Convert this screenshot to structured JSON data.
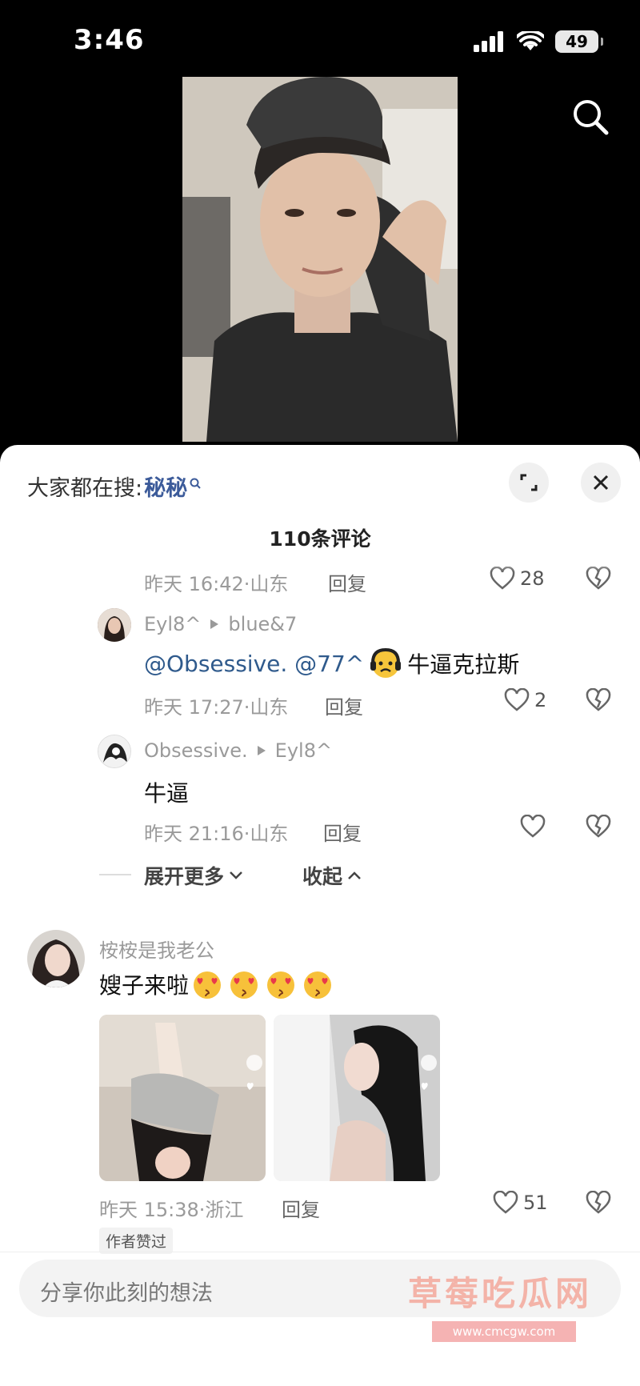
{
  "status_bar": {
    "time": "3:46",
    "battery": "49"
  },
  "sheet": {
    "hot_search_prefix": "大家都在搜:",
    "hot_search_keyword": "秘秘",
    "comment_count": "110条评论"
  },
  "comments": {
    "partial_meta": {
      "time": "昨天 16:42·山东",
      "reply": "回复",
      "likes": "28"
    },
    "reply1": {
      "user": "Eyl8^",
      "to": "blue&7",
      "mention": "@Obsessive. @77^",
      "text": "牛逼克拉斯",
      "time": "昨天 17:27·山东",
      "reply": "回复",
      "likes": "2"
    },
    "reply2": {
      "user": "Obsessive.",
      "to": "Eyl8^",
      "text": "牛逼",
      "time": "昨天 21:16·山东",
      "reply": "回复",
      "likes": ""
    },
    "expand": "展开更多",
    "collapse": "收起",
    "main": {
      "user": "桉桉是我老公",
      "text": "嫂子来啦",
      "time": "昨天 15:38·浙江",
      "reply": "回复",
      "likes": "51",
      "tag": "作者赞过"
    }
  },
  "input": {
    "placeholder": "分享你此刻的想法"
  },
  "watermark": {
    "text": "草莓吃瓜网",
    "url": "www.cmcgw.com"
  },
  "colors": {
    "mention": "#2f5a8c",
    "keyword": "#3c5b9a"
  }
}
